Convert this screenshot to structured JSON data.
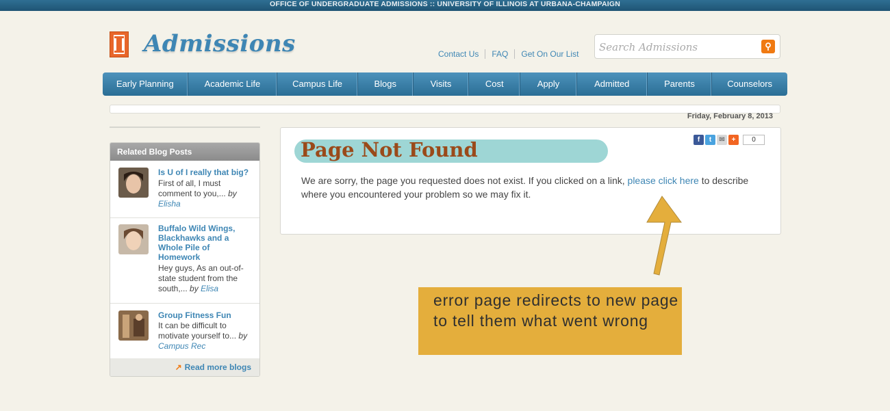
{
  "topbar": {
    "text": "OFFICE OF UNDERGRADUATE ADMISSIONS :: UNIVERSITY OF ILLINOIS AT URBANA-CHAMPAIGN"
  },
  "header": {
    "logo_text": "Admissions",
    "links": [
      "Contact Us",
      "FAQ",
      "Get On Our List"
    ],
    "search_placeholder": "Search Admissions"
  },
  "nav": {
    "items": [
      "Early Planning",
      "Academic Life",
      "Campus Life",
      "Blogs",
      "Visits",
      "Cost",
      "Apply",
      "Admitted",
      "Parents",
      "Counselors"
    ]
  },
  "date": "Friday, February 8, 2013",
  "sidebar": {
    "title": "Related Blog Posts",
    "posts": [
      {
        "title": "Is U of I really that big?",
        "excerpt": "First of all, I must comment to you,...",
        "by": "by",
        "author": "Elisha"
      },
      {
        "title": "Buffalo Wild Wings, Blackhawks and a Whole Pile of Homework",
        "excerpt": "Hey guys, As an out-of-state student from the south,...",
        "by": "by",
        "author": "Elisa"
      },
      {
        "title": "Group Fitness Fun",
        "excerpt": "It can be difficult to motivate yourself to...",
        "by": "by",
        "author": "Campus Rec"
      }
    ],
    "more": "Read more blogs"
  },
  "main": {
    "title": "Page Not Found",
    "message_before": "We are sorry, the page you requested does not exist. If you clicked on a link,",
    "link_text": "please click here",
    "message_after": "to describe where you encountered your problem so we may fix it.",
    "share_count": "0"
  },
  "annotation": {
    "text": "error page redirects to new page to tell them what went wrong"
  },
  "colors": {
    "accent": "#3e86b4",
    "orange": "#f07a12",
    "title": "#9a4a1a",
    "highlight": "#9ed6d5",
    "note": "#e4ae3c"
  }
}
